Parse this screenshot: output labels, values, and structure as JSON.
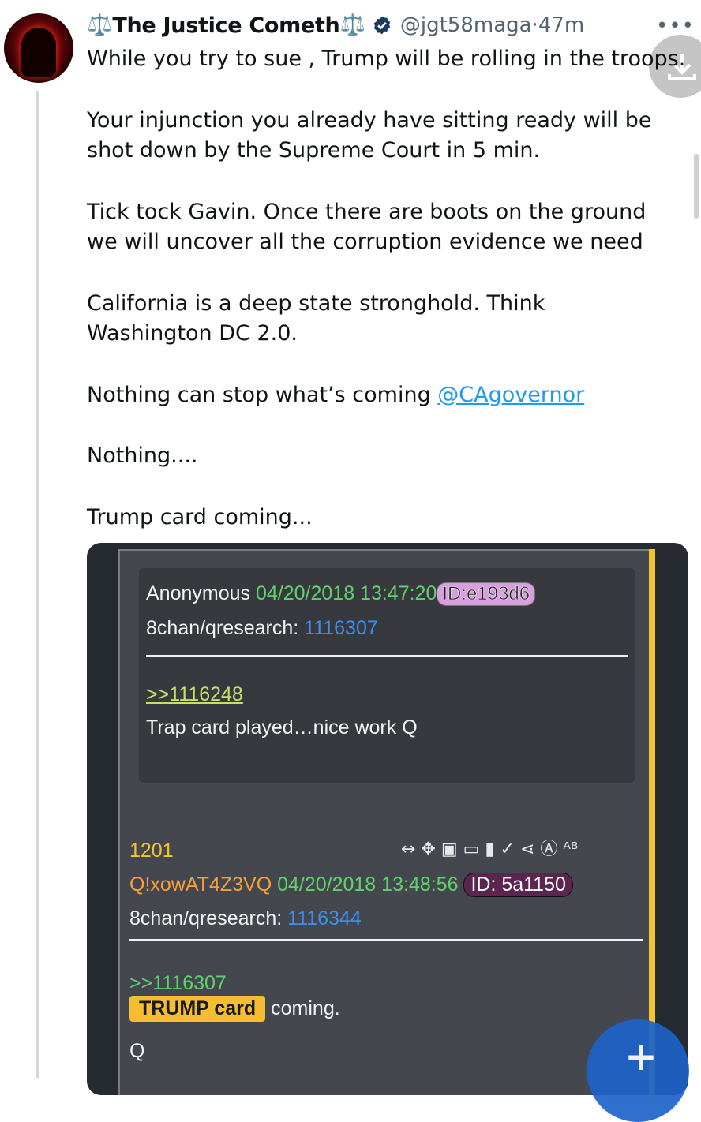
{
  "post": {
    "display_name": "The Justice Cometh",
    "scale_glyph": "⚖️",
    "handle": "@jgt58maga",
    "separator": "·",
    "time": "47m",
    "more_label": "•••",
    "paragraphs": [
      "While you try to sue , Trump will be rolling in the troops.",
      "Your injunction you already have sitting ready will be",
      "shot down by the Supreme Court in 5 min.",
      "Tick tock Gavin. Once there are boots on the ground",
      "we will uncover all the corruption evidence we need",
      "California is a deep state stronghold. Think",
      "Washington DC 2.0.",
      "Nothing can stop what’s coming ",
      "Nothing....",
      "Trump card coming..."
    ],
    "mention": "@CAgovernor"
  },
  "q_image": {
    "prev_post": {
      "author": "Anonymous",
      "datetime": "04/20/2018 13:47:20",
      "id_tag": "ID:e193d6",
      "board": "8chan/qresearch:",
      "post_number": "1116307",
      "reply_ref": ">>1116248",
      "body": "Trap card played…nice work Q"
    },
    "q_post": {
      "number": "1201",
      "tripcode": "Q!xowAT4Z3VQ",
      "datetime": "04/20/2018 13:48:56",
      "id_tag": "ID: 5a1150",
      "board": "8chan/qresearch:",
      "post_number": "1116344",
      "reply_ref": ">>1116307",
      "highlight": "TRUMP card",
      "body_rest": "coming.",
      "signature": "Q",
      "toolbar_icons": "↔ ✥ ▣ ▭ ▮ ✓ ⋖ Ⓐ ᴬᴮ"
    }
  },
  "colors": {
    "accent_blue": "#1d9bf0",
    "q_green": "#5fd36b",
    "q_yellow": "#f0c52f",
    "q_blue": "#3b8ff0",
    "q_orange": "#f7a03a"
  },
  "icons": {
    "verified": "verified-badge-icon",
    "download": "download-icon",
    "compose": "plus-icon"
  }
}
